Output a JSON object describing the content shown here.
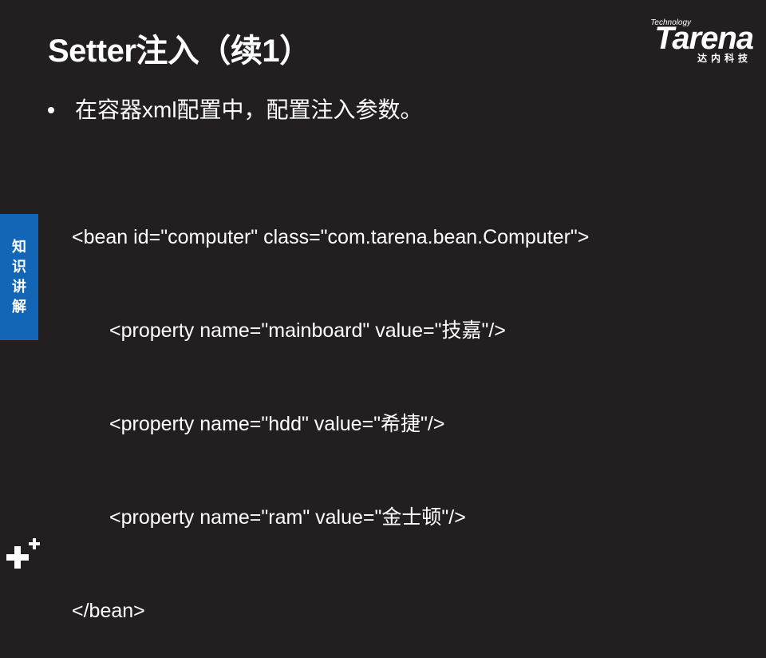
{
  "slide": {
    "title": "Setter注入（续1）",
    "bullet": "在容器xml配置中，配置注入参数。"
  },
  "logo": {
    "small_text": "Technology",
    "word": "Tarena",
    "sub_text": "达内科技"
  },
  "code": {
    "lines": [
      "<bean id=\"computer\" class=\"com.tarena.bean.Computer\">",
      "<property name=\"mainboard\" value=\"技嘉\"/>",
      "<property name=\"hdd\" value=\"希捷\"/>",
      "<property name=\"ram\" value=\"金士顿\"/>",
      "</bean>"
    ]
  },
  "side_tab": {
    "chars": [
      "知",
      "识",
      "讲",
      "解"
    ]
  },
  "colors": {
    "background": "#231f20",
    "text": "#ffffff",
    "side_tab": "#1366b5"
  },
  "icons": {
    "corner": "plus-icon"
  }
}
